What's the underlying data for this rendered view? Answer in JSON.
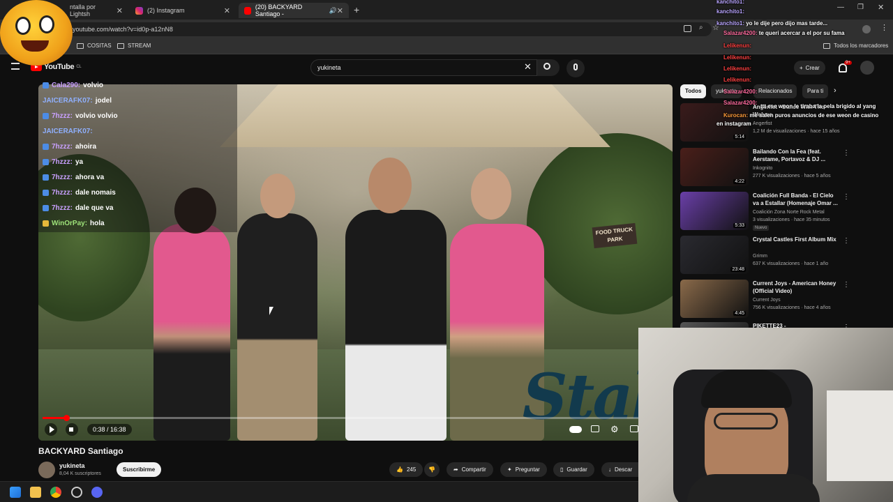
{
  "browser": {
    "tabs": [
      {
        "label": "ntalla por Lightsh"
      },
      {
        "label": "(2) Instagram"
      },
      {
        "label": "(20) BACKYARD Santiago -"
      }
    ],
    "url": "youtube.com/watch?v=id0p-a12nN8",
    "bookmarks": [
      "COSITAS",
      "STREAM"
    ],
    "bookmarks_right": "Todos los marcadores"
  },
  "youtube": {
    "logo": "YouTube",
    "region": "CL",
    "search_value": "yukineta",
    "create_label": "Crear",
    "notif_count": "9+"
  },
  "video": {
    "progress_fraction": 0.04,
    "time": "0:38 / 16:38",
    "food_truck_sign": "FOOD TRUCK PARK",
    "watermark": "Stak",
    "title": "BACKYARD Santiago",
    "channel": "yukineta",
    "subscribers": "8,04 K suscriptores",
    "subscribe_label": "Suscribirme",
    "likes": "245",
    "share_label": "Compartir",
    "ask_label": "Preguntar",
    "save_label": "Guardar",
    "download_label": "Descar"
  },
  "overlay_chat": [
    {
      "user": "Cala290:",
      "text": "volvio",
      "color": "#c9a0ff",
      "badge": "b"
    },
    {
      "user": "JAICERAFK07:",
      "text": "jodel",
      "color": "#8fb0ff",
      "badge": ""
    },
    {
      "user": "7hzzz:",
      "text": "volvio volvio",
      "color": "#c9a0ff",
      "badge": "b"
    },
    {
      "user": "JAICERAFK07:",
      "text": "",
      "color": "#8fb0ff",
      "badge": ""
    },
    {
      "user": "7hzzz:",
      "text": "ahoira",
      "color": "#c9a0ff",
      "badge": "b"
    },
    {
      "user": "7hzzz:",
      "text": "ya",
      "color": "#c9a0ff",
      "badge": "b"
    },
    {
      "user": "7hzzz:",
      "text": "ahora va",
      "color": "#c9a0ff",
      "badge": "b"
    },
    {
      "user": "7hzzz:",
      "text": "dale nomais",
      "color": "#c9a0ff",
      "badge": "b"
    },
    {
      "user": "7hzzz:",
      "text": "dale que va",
      "color": "#c9a0ff",
      "badge": "b"
    },
    {
      "user": "WinOrPay:",
      "text": "hola",
      "color": "#9fe37a",
      "badge": "y"
    }
  ],
  "stream_chat": [
    {
      "user": "kanchito1:",
      "text": "",
      "color": "#b9a5ff"
    },
    {
      "user": "kanchito1:",
      "text": "",
      "color": "#b9a5ff"
    },
    {
      "user": "kanchito1:",
      "text": "yo le dije pero dijo mas tarde...",
      "color": "#b9a5ff"
    },
    {
      "user": "Salazar4200:",
      "text": "te queri acercar a el por su fama",
      "color": "#ff6b9e"
    },
    {
      "user": "Lelikenun:",
      "text": "",
      "color": "#ff4040"
    },
    {
      "user": "Lelikenun:",
      "text": "",
      "color": "#ff4040"
    },
    {
      "user": "Lelikenun:",
      "text": "",
      "color": "#ff4040"
    },
    {
      "user": "Lelikenun:",
      "text": "",
      "color": "#ff4040"
    },
    {
      "user": "Salazar4200:",
      "text": "",
      "color": "#ff6b9e"
    },
    {
      "user": "Salazar4200:",
      "text": "",
      "color": "#ff6b9e"
    },
    {
      "user": "",
      "text": "ttt ese weon le tiraba la pela brigido al yang",
      "color": "#ffffff"
    },
    {
      "user": "Kurocan:",
      "text": "me salen puros anuncios de ese weon de casino",
      "color": "#ff9b3a"
    },
    {
      "user": "",
      "text": "en instagram",
      "color": "#ffffff"
    }
  ],
  "chips": [
    "Todos",
    "yukineta",
    "Relacionados",
    "Para ti"
  ],
  "recommendations": [
    {
      "title": "Angerfist - Dance With The Wolves",
      "channel": "Angerfist",
      "meta": "1,2 M de visualizaciones · hace 15 años",
      "duration": "5:14",
      "color": "#3a1b1b",
      "new": ""
    },
    {
      "title": "Bailando Con la Fea (feat. Aerstame, Portavoz & DJ ...",
      "channel": "Inkognito",
      "meta": "277 K visualizaciones · hace 5 años",
      "duration": "4:22",
      "color": "#4a1f1a",
      "new": ""
    },
    {
      "title": "Coalición Full Banda - El Cielo va a Estallar (Homenaje Omar ...",
      "channel": "Coalición Zona Norte Rock Metal",
      "meta": "3 visualizaciones · hace 35 minutos",
      "duration": "5:33",
      "color": "#6a3fa8",
      "new": "Nuevo"
    },
    {
      "title": "Crystal Castles  First Album Mix",
      "channel": "Grimm",
      "meta": "637 K visualizaciones · hace 1 año",
      "duration": "23:48",
      "color": "#2a2a30",
      "new": ""
    },
    {
      "title": "Current Joys - American Honey (Official Video)",
      "channel": "Current Joys",
      "meta": "756 K visualizaciones · hace 4 años",
      "duration": "4:45",
      "color": "#8a6a4a",
      "new": ""
    },
    {
      "title": "PIKETTE23 -",
      "channel": "",
      "meta": "",
      "duration": "",
      "color": "#555",
      "new": ""
    }
  ]
}
